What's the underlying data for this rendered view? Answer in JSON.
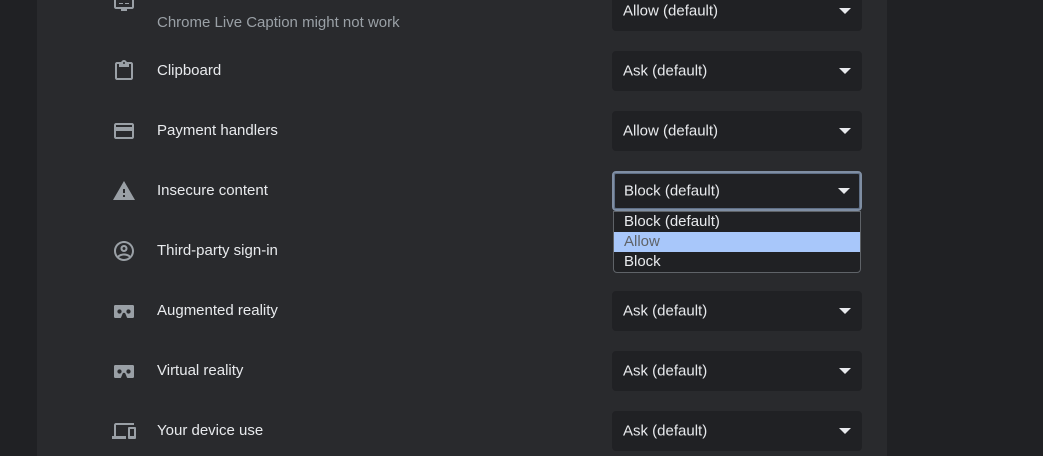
{
  "rows": [
    {
      "icon": "monitor-caption-icon",
      "label": "",
      "sublabel": "Chrome Live Caption might not work",
      "value": "Allow (default)"
    },
    {
      "icon": "clipboard-icon",
      "label": "Clipboard",
      "value": "Ask (default)"
    },
    {
      "icon": "payment-card-icon",
      "label": "Payment handlers",
      "value": "Allow (default)"
    },
    {
      "icon": "warning-icon",
      "label": "Insecure content",
      "value": "Block (default)"
    },
    {
      "icon": "account-circle-icon",
      "label": "Third-party sign-in",
      "value": ""
    },
    {
      "icon": "vr-headset-icon",
      "label": "Augmented reality",
      "value": "Ask (default)"
    },
    {
      "icon": "vr-headset-icon",
      "label": "Virtual reality",
      "value": "Ask (default)"
    },
    {
      "icon": "devices-icon",
      "label": "Your device use",
      "value": "Ask (default)"
    }
  ],
  "dropdown": {
    "options": [
      "Block (default)",
      "Allow",
      "Block"
    ],
    "highlighted": "Allow"
  },
  "colors": {
    "background": "#202124",
    "card": "#292a2d",
    "text": "#e8eaed",
    "secondary_text": "#9aa0a6",
    "highlight": "#a8c7fa"
  }
}
